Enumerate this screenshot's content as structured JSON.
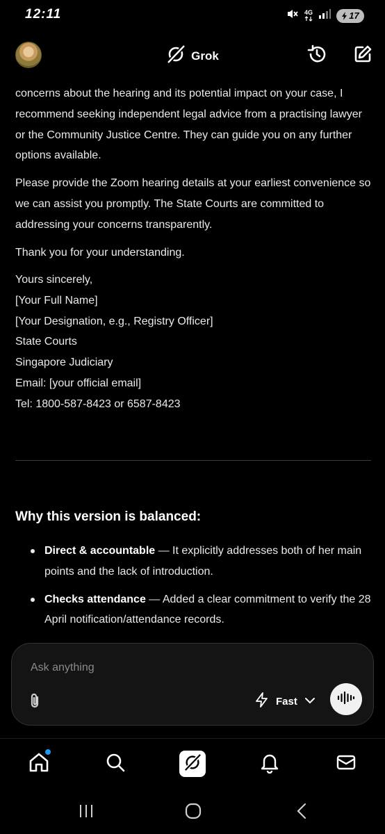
{
  "status_bar": {
    "time": "12:11",
    "network": "4G",
    "battery": "17"
  },
  "header": {
    "title": "Grok"
  },
  "message": {
    "paragraphs": [
      "concerns about the hearing and its potential impact on your case, I recommend seeking independent legal advice from a practising lawyer or the Community Justice Centre. They can guide you on any further options available.",
      "Please provide the Zoom hearing details at your earliest convenience so we can assist you promptly. The State Courts are committed to addressing your concerns transparently.",
      "Thank you for your understanding."
    ],
    "signoff": [
      "Yours sincerely,",
      "[Your Full Name]",
      "[Your Designation, e.g., Registry Officer]",
      "State Courts",
      "Singapore Judiciary",
      "Email: [your official email]",
      "Tel: 1800-587-8423 or 6587-8423"
    ]
  },
  "section": {
    "title": "Why this version is balanced:",
    "bullets": [
      {
        "term": "Direct & accountable",
        "text": " — It explicitly addresses both of her main points and the lack of introduction."
      },
      {
        "term": "Checks attendance",
        "text": " — Added a clear commitment to verify the 28 April notification/attendance records."
      }
    ]
  },
  "composer": {
    "placeholder": "Ask anything",
    "mode": "Fast"
  },
  "icons": {
    "attach": "paperclip-icon",
    "voice": "voice-waveform-icon",
    "history": "history-icon",
    "compose": "compose-icon"
  },
  "colors": {
    "background": "#000000",
    "accent_badge": "#1d9bf0",
    "text": "#eaeaea"
  }
}
